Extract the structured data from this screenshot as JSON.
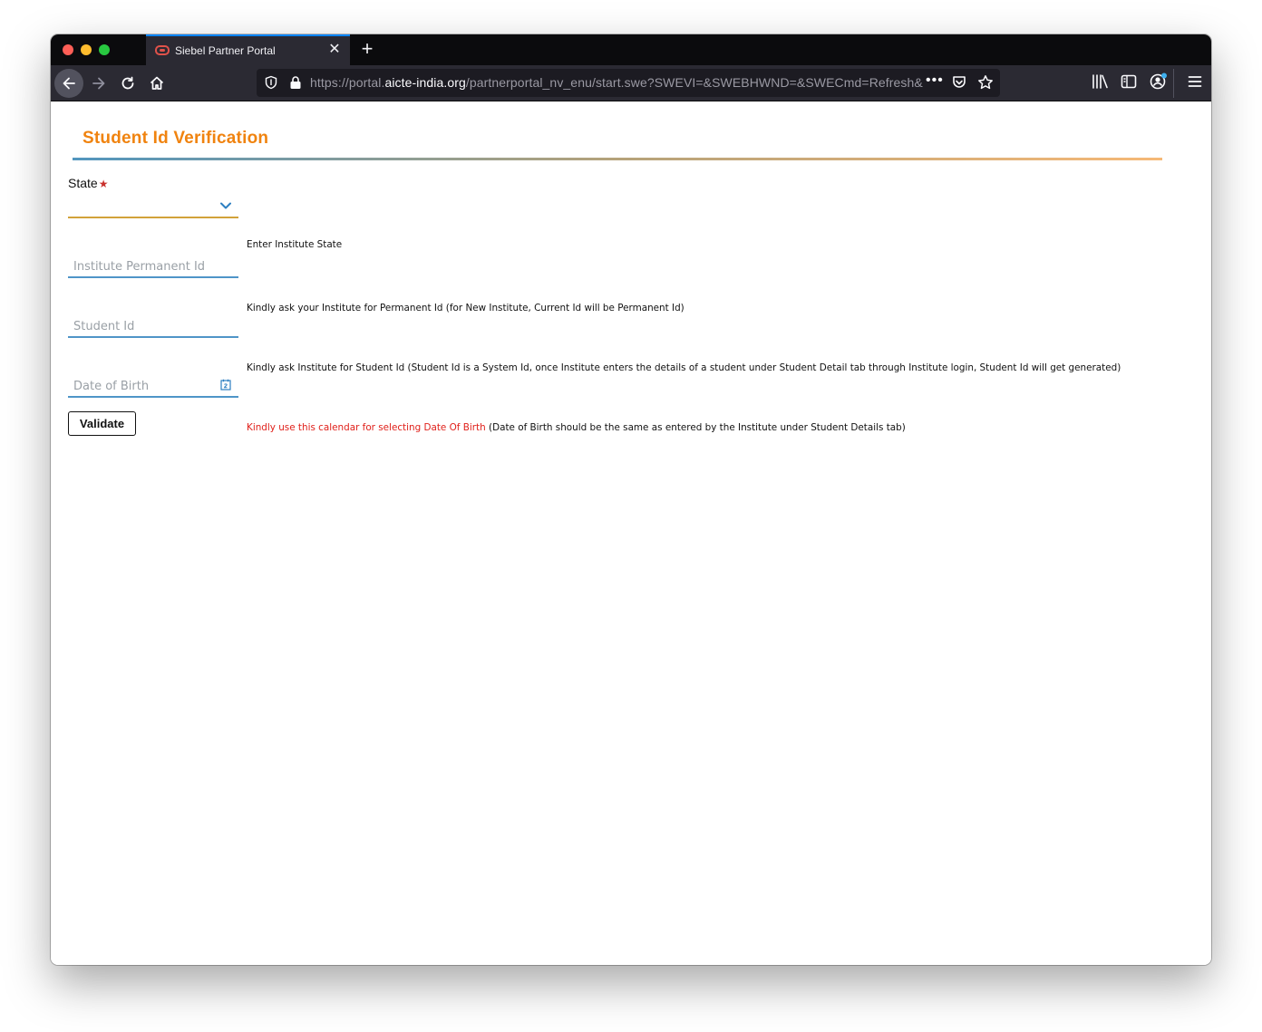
{
  "browser": {
    "tab_title": "Siebel Partner Portal",
    "close_tab_symbol": "✕",
    "new_tab_symbol": "+",
    "url": {
      "prefix": "https://portal.",
      "host": "aicte-india.org",
      "path": "/partnerportal_nv_enu/start.swe?SWEVI=&SWEBHWND=&SWECmd=Refresh&"
    },
    "more_symbol": "•••"
  },
  "page": {
    "heading": "Student Id Verification",
    "state_label": "State",
    "required_mark": "★",
    "state_hint": "Enter Institute State",
    "pid_placeholder": "Institute Permanent Id",
    "pid_hint": "Kindly ask your Institute for Permanent Id (for New Institute, Current Id will be Permanent Id)",
    "sid_placeholder": "Student Id",
    "sid_hint": "Kindly ask Institute for Student Id (Student Id is a System Id, once Institute enters the details of a student under Student Detail tab through Institute login, Student Id will get generated)",
    "dob_placeholder": "Date of Birth",
    "dob_hint_red": "Kindly use this calendar for selecting Date Of Birth",
    "dob_hint_rest": " (Date of Birth should be the same as entered by the Institute under Student Details tab)",
    "validate_label": "Validate"
  },
  "colors": {
    "heading": "#f0830f",
    "field_underline": "#4f95c8",
    "state_underline": "#d2a23a",
    "hint_red": "#e0201a"
  }
}
